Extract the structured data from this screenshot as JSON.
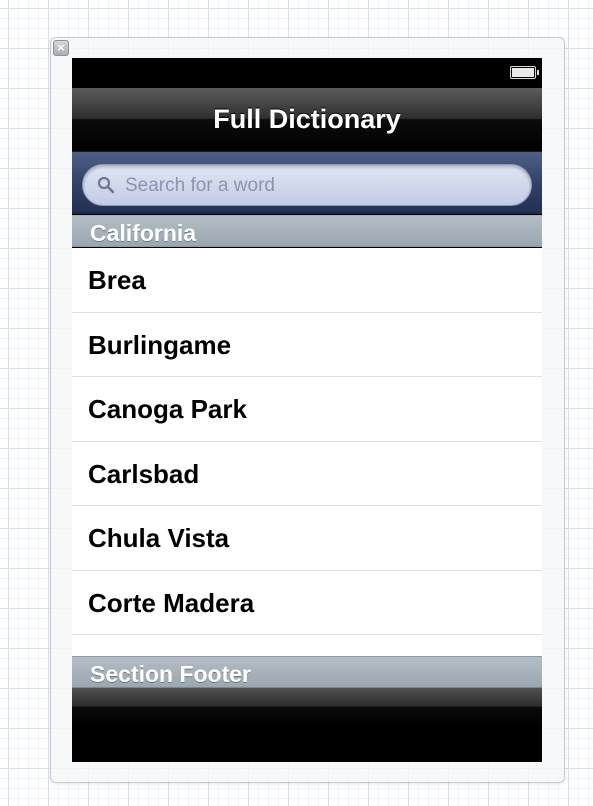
{
  "window": {
    "close_symbol": "×"
  },
  "nav": {
    "title": "Full Dictionary"
  },
  "search": {
    "placeholder": "Search for a word",
    "icon": "search-icon"
  },
  "table": {
    "section_header": "California",
    "rows": [
      {
        "label": "Brea"
      },
      {
        "label": "Burlingame"
      },
      {
        "label": "Canoga Park"
      },
      {
        "label": "Carlsbad"
      },
      {
        "label": "Chula Vista"
      },
      {
        "label": "Corte Madera"
      }
    ],
    "section_footer": "Section Footer"
  },
  "colors": {
    "nav_bar": "#000000",
    "search_bar": "#34426a",
    "section_header": "#a8b2bc"
  }
}
